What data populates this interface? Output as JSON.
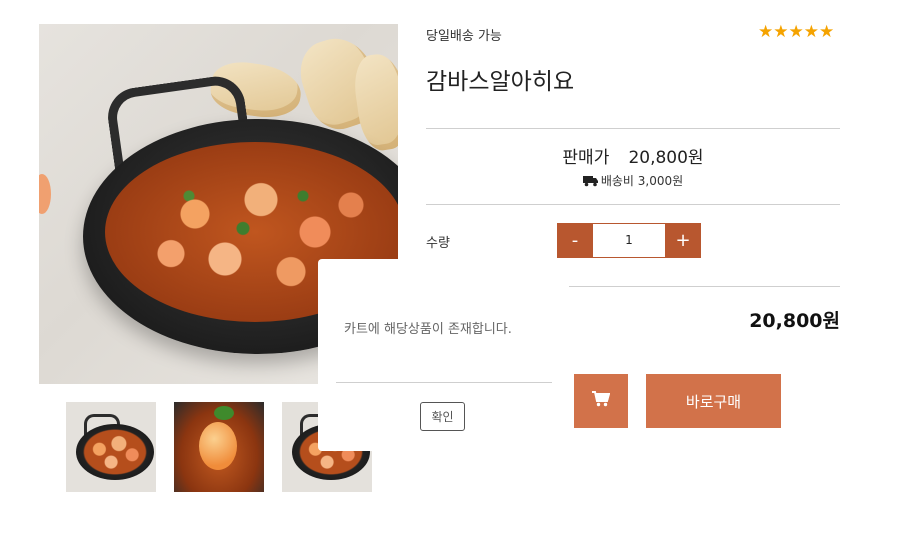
{
  "product": {
    "delivery_tag": "당일배송 가능",
    "rating_stars": "★★★★★",
    "rating": 5,
    "title": "감바스알아히요",
    "price_label": "판매가",
    "price": "20,800원",
    "shipping": "배송비 3,000원",
    "quantity_label": "수량",
    "quantity": "1",
    "decrement": "-",
    "increment": "+",
    "total": "20,800원",
    "buy_now": "바로구매"
  },
  "icons": {
    "cart": "cart-icon",
    "truck": "truck-icon",
    "star": "star-icon"
  },
  "colors": {
    "accent": "#d2724a",
    "qty_button": "#b8572f",
    "stars": "#f5a300"
  },
  "dialog": {
    "message": "카트에 해당상품이 존재합니다.",
    "confirm": "확인"
  }
}
